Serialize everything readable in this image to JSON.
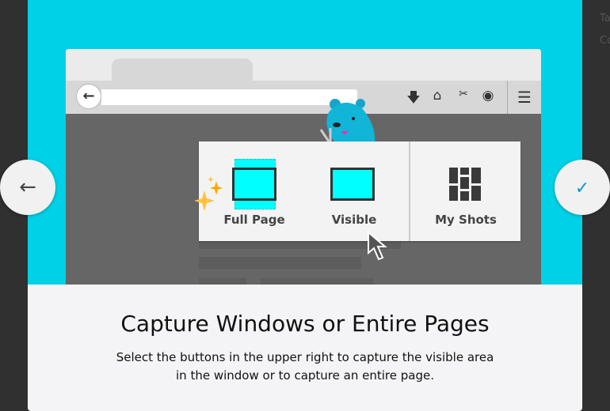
{
  "background": {
    "partial_text": [
      "Ta",
      "Co"
    ]
  },
  "illustration": {
    "buttons": [
      "Full Page",
      "Visible",
      "My Shots"
    ],
    "toolbar_icons": [
      "back-arrow-icon",
      "download-icon",
      "home-icon",
      "screenshots-icon",
      "extension-icon",
      "menu-icon"
    ]
  },
  "slide": {
    "title": "Capture Windows or Entire Pages",
    "description_line1": "Select the buttons in the upper right to capture the visible area",
    "description_line2": "in the window or to capture an entire page."
  },
  "nav": {
    "prev_icon": "arrow-left-icon",
    "done_icon": "checkmark-icon"
  },
  "colors": {
    "hero": "#00d1e6",
    "accent": "#0a9cc9",
    "highlight": "#00ffff",
    "sparkle": "#ffb020"
  }
}
